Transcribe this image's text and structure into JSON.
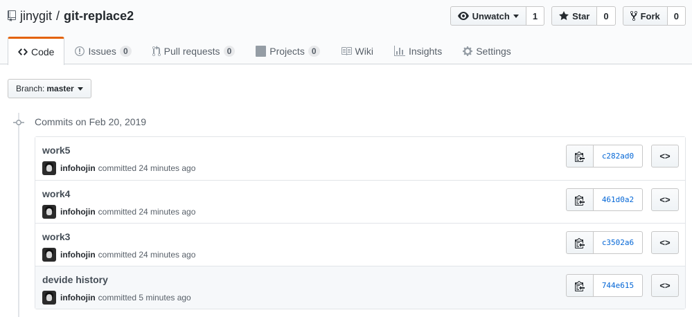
{
  "repo": {
    "owner": "jinygit",
    "separator": "/",
    "name": "git-replace2"
  },
  "actions": {
    "watch_label": "Unwatch",
    "watch_count": "1",
    "star_label": "Star",
    "star_count": "0",
    "fork_label": "Fork",
    "fork_count": "0"
  },
  "nav": {
    "code": "Code",
    "issues": "Issues",
    "issues_count": "0",
    "pulls": "Pull requests",
    "pulls_count": "0",
    "projects": "Projects",
    "projects_count": "0",
    "wiki": "Wiki",
    "insights": "Insights",
    "settings": "Settings"
  },
  "branch": {
    "prefix": "Branch:",
    "name": "master"
  },
  "commit_group": {
    "title": "Commits on Feb 20, 2019"
  },
  "commits": [
    {
      "title": "work5",
      "author": "infohojin",
      "action": "committed 24 minutes ago",
      "sha": "c282ad0",
      "browse": "<>"
    },
    {
      "title": "work4",
      "author": "infohojin",
      "action": "committed 24 minutes ago",
      "sha": "461d0a2",
      "browse": "<>"
    },
    {
      "title": "work3",
      "author": "infohojin",
      "action": "committed 24 minutes ago",
      "sha": "c3502a6",
      "browse": "<>"
    },
    {
      "title": "devide history",
      "author": "infohojin",
      "action": "committed 5 minutes ago",
      "sha": "744e615",
      "browse": "<>"
    }
  ],
  "colors": {
    "accent_tab": "#e36209",
    "link": "#0366d6"
  },
  "icons": {
    "repo": "repo-icon",
    "eye": "eye-icon",
    "star": "star-icon",
    "fork": "fork-icon",
    "code": "code-icon",
    "issue": "issue-icon",
    "pull": "pull-request-icon",
    "project": "project-icon",
    "wiki": "book-icon",
    "graph": "graph-icon",
    "gear": "gear-icon",
    "clipboard": "clipboard-icon",
    "commit": "commit-node-icon"
  }
}
